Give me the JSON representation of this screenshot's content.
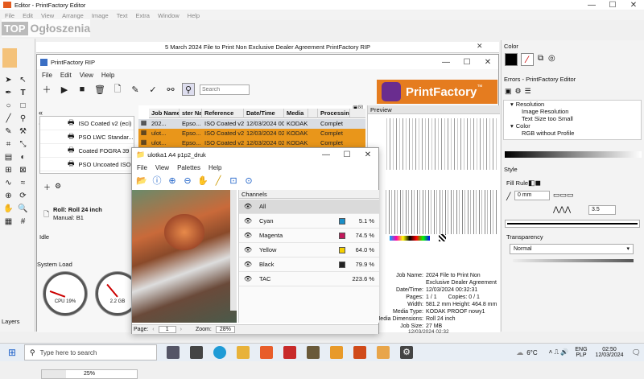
{
  "editor": {
    "title": "Editor - PrintFactory Editor",
    "menu": [
      "File",
      "Edit",
      "View",
      "Arrange",
      "Image",
      "Text",
      "Extra",
      "Window",
      "Help"
    ],
    "doc_title": "5 March 2024 File to Print Non Exclusive Dealer Agreement PrintFactory RIP"
  },
  "watermark": {
    "top": "TOP",
    "name": "Ogłoszenia"
  },
  "rip": {
    "title": "PrintFactory RIP",
    "menu": [
      "File",
      "Edit",
      "View",
      "Help"
    ],
    "search_placeholder": "Search",
    "logo_text": "PrintFactory",
    "logo_tm": "™",
    "queues": [
      "ISO Coated v2 (eci)",
      "PSO LWC Standar...",
      "Coated FOGRA 39",
      "PSO Uncoated ISO"
    ],
    "roll": "Roll: Roll 24 inch",
    "manual": "Manual: B1",
    "idle": "Idle",
    "system_load": "System Load",
    "cpu": "CPU 19%",
    "mem": "2.2 GB",
    "cpu_pct": 0.19,
    "layers": "Layers",
    "progress": "25%",
    "progress_value": 0.25
  },
  "table": {
    "headers": [
      "Job Name",
      "ster Na",
      "Reference",
      "Date/Time",
      "Media",
      "",
      "Processing"
    ],
    "rows": [
      [
        "202...",
        "Epso...",
        "ISO Coated v2...",
        "12/03/2024 00...",
        "KODAK...",
        "",
        "Complet"
      ],
      [
        "ulot...",
        "Epso...",
        "ISO Coated v2...",
        "12/03/2024 02...",
        "KODAK...",
        "",
        "Complet"
      ],
      [
        "ulot...",
        "Epso...",
        "ISO Coated v2...",
        "12/03/2024 02...",
        "KODAK...",
        "",
        "Complet"
      ]
    ]
  },
  "preview": {
    "title": "Preview",
    "labels": [
      "Job Name:",
      "Date/Time:",
      "Pages:",
      "Width:",
      "Media Type:",
      "Media Dimensions:",
      "Job Size:"
    ],
    "values": [
      "2024 File to Print Non",
      "Exclusive Dealer Agreement",
      "12/03/2024 00:32:31",
      "1 / 1",
      "581.2 mm  Height: 464.8 mm",
      "KODAK PROOF nowy1",
      "Roll 24 inch",
      "27 MB"
    ],
    "copies_label": "Copies: 0 / 1",
    "status_time": "12/03/2024 02:32"
  },
  "viewer": {
    "title": "ulotka1 A4 p1p2_druk",
    "menu": [
      "File",
      "View",
      "Palettes",
      "Help"
    ],
    "channels_title": "Channels",
    "page_label": "Page:",
    "page_value": "1",
    "zoom_label": "Zoom:",
    "zoom_value": "28%"
  },
  "channels": [
    {
      "name": "All",
      "value": "",
      "color": ""
    },
    {
      "name": "Cyan",
      "value": "5.1 %",
      "color": "#1a8fc8"
    },
    {
      "name": "Magenta",
      "value": "74.5 %",
      "color": "#c2185b"
    },
    {
      "name": "Yellow",
      "value": "64.0 %",
      "color": "#f5d000"
    },
    {
      "name": "Black",
      "value": "79.9 %",
      "color": "#222222"
    },
    {
      "name": "TAC",
      "value": "223.6 %",
      "color": ""
    }
  ],
  "right": {
    "color_title": "Color",
    "errors_title": "Errors - PrintFactory Editor",
    "errors": [
      "Resolution",
      "Image Resolution",
      "Text Size too Small",
      "Color",
      "RGB without Profile"
    ],
    "style_title": "Style",
    "fill_rule": "Fill Rule",
    "stroke_value": "0 mm",
    "miter_value": "3.5",
    "transparency_title": "Transparency",
    "blend_mode": "Normal"
  },
  "taskbar": {
    "search_placeholder": "Type here to search",
    "weather": "6°C",
    "lang1": "ENG",
    "lang2": "PLP",
    "time": "02:50",
    "date": "12/03/2024"
  }
}
